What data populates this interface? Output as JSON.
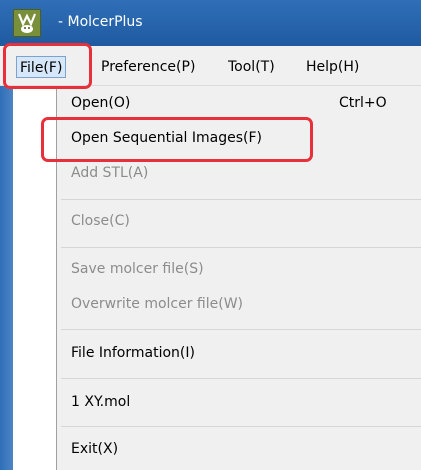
{
  "window": {
    "title": "- MolcerPlus",
    "app_icon": "molcer-app-icon"
  },
  "menubar": {
    "items": [
      {
        "label": "File(F)",
        "active": true
      },
      {
        "label": "Preference(P)"
      },
      {
        "label": "Tool(T)"
      },
      {
        "label": "Help(H)"
      }
    ]
  },
  "file_menu": {
    "items": [
      {
        "label": "Open(O)",
        "shortcut": "Ctrl+O",
        "enabled": true
      },
      {
        "label": "Open Sequential Images(F)",
        "enabled": true
      },
      {
        "label": "Add STL(A)",
        "enabled": false
      },
      {
        "label": "Close(C)",
        "enabled": false
      },
      {
        "label": "Save molcer file(S)",
        "enabled": false
      },
      {
        "label": "Overwrite molcer file(W)",
        "enabled": false
      },
      {
        "label": "File Information(I)",
        "enabled": true
      },
      {
        "label": "1 XY.mol",
        "enabled": true
      },
      {
        "label": "Exit(X)",
        "enabled": true
      }
    ]
  },
  "colors": {
    "annotation_red": "#e8303a",
    "titlebar_blue": "#1f5aa0",
    "disabled_gray": "#8c8c8c"
  }
}
